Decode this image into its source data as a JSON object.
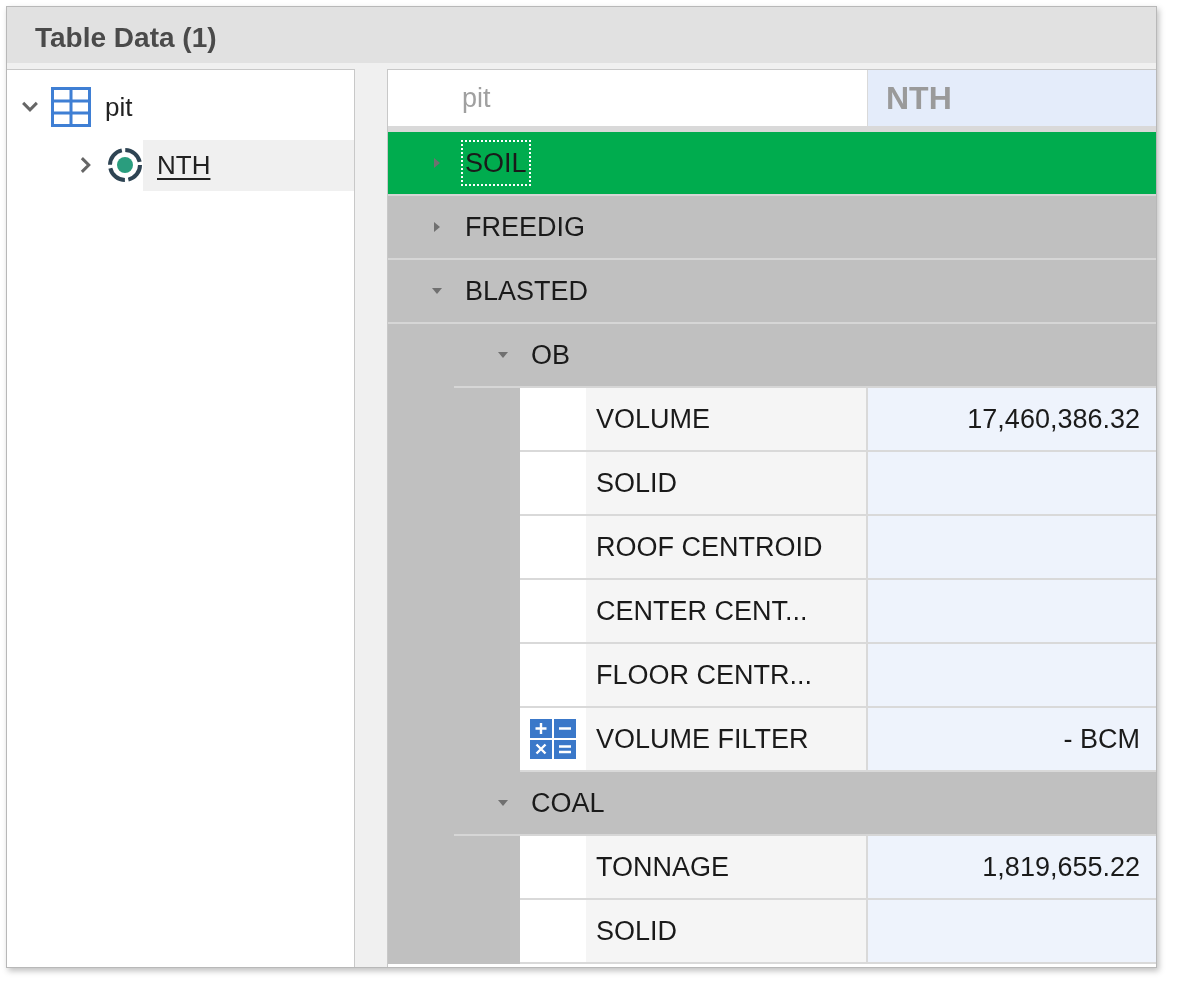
{
  "panel": {
    "title": "Table Data (1)"
  },
  "tree": [
    {
      "label": "pit",
      "expanded": true,
      "selected": false,
      "children": [
        {
          "label": "NTH",
          "expanded": false,
          "selected": true
        }
      ]
    }
  ],
  "grid": {
    "columns": [
      "pit",
      "NTH"
    ],
    "groups": [
      {
        "label": "SOIL",
        "expanded": false,
        "selected": true
      },
      {
        "label": "FREEDIG",
        "expanded": false,
        "selected": false
      },
      {
        "label": "BLASTED",
        "expanded": true,
        "selected": false,
        "children": [
          {
            "label": "OB",
            "expanded": true,
            "selected": false,
            "rows": [
              {
                "kind": "plain",
                "name": "VOLUME",
                "value": "17,460,386.32"
              },
              {
                "kind": "plain",
                "name": "SOLID"
              },
              {
                "kind": "plain",
                "name": "ROOF CENTROID"
              },
              {
                "kind": "plain",
                "name": "CENTER CENT..."
              },
              {
                "kind": "plain",
                "name": "FLOOR CENTR..."
              },
              {
                "kind": "calculator",
                "name": "VOLUME FILTER",
                "value": "- BCM"
              }
            ]
          },
          {
            "label": "COAL",
            "expanded": true,
            "selected": false,
            "rows": [
              {
                "kind": "plain",
                "name": "TONNAGE",
                "value": "1,819,655.22"
              },
              {
                "kind": "plain",
                "name": "SOLID"
              }
            ]
          }
        ]
      }
    ]
  }
}
